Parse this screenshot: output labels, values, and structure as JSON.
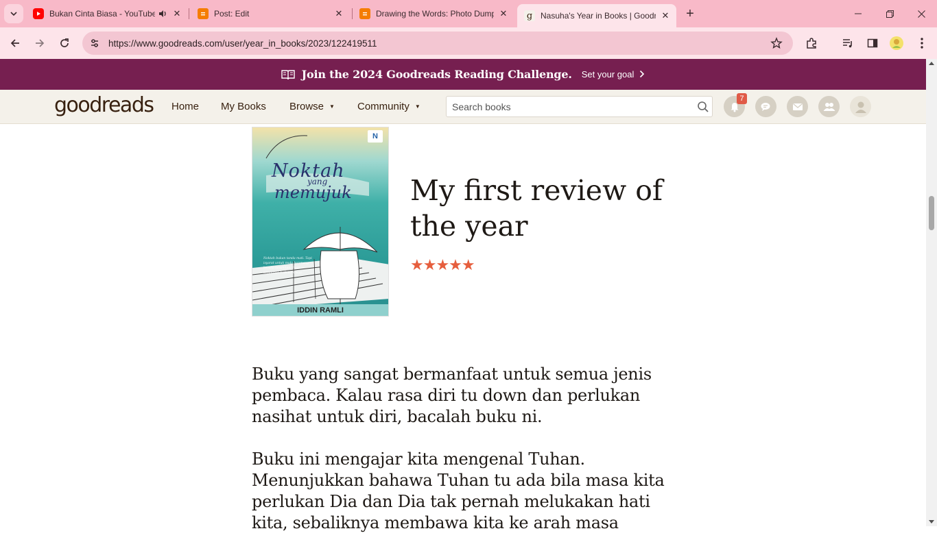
{
  "browser": {
    "tabs": [
      {
        "title": "Bukan Cinta Biasa - YouTube",
        "favicon": "youtube-icon",
        "audio": true
      },
      {
        "title": "Post: Edit",
        "favicon": "blogger-icon"
      },
      {
        "title": "Drawing the Words: Photo Dump",
        "favicon": "blogger-icon"
      },
      {
        "title": "Nasuha's Year in Books | Goodreads",
        "favicon": "goodreads-icon",
        "active": true
      }
    ],
    "url": "https://www.goodreads.com/user/year_in_books/2023/122419511",
    "colors": {
      "frame": "#f8b9c8",
      "toolbar": "#fde4ea",
      "omnibox": "#f3c6d2"
    }
  },
  "banner": {
    "headline": "Join the 2024 Goodreads Reading Challenge.",
    "cta": "Set your goal",
    "color": "#761f50"
  },
  "header": {
    "logo": {
      "light": "good",
      "bold": "reads"
    },
    "nav": [
      "Home",
      "My Books",
      "Browse",
      "Community"
    ],
    "search_placeholder": "Search books",
    "notification_count": "7",
    "icons": [
      "notifications-icon",
      "discussions-icon",
      "messages-icon",
      "friends-icon",
      "profile-avatar-icon"
    ]
  },
  "book": {
    "cover": {
      "title_line1": "Noktah",
      "title_line2": "yang",
      "title_line3": "memujuk",
      "author": "IDDIN RAMLI",
      "publisher_mark": "N"
    }
  },
  "review": {
    "title": "My first review of the year",
    "rating": 5,
    "stars": "★★★★★",
    "star_color": "#e65e3d",
    "paragraphs": [
      "Buku yang sangat bermanfaat untuk semua jenis pembaca. Kalau rasa diri tu down dan perlukan nasihat untuk diri, bacalah buku ni.",
      "Buku ini mengajar kita mengenal Tuhan. Menunjukkan bahawa Tuhan tu ada bila masa kita perlukan Dia dan Dia tak pernah melukakan hati kita, sebaliknya membawa kita ke arah masa"
    ]
  }
}
